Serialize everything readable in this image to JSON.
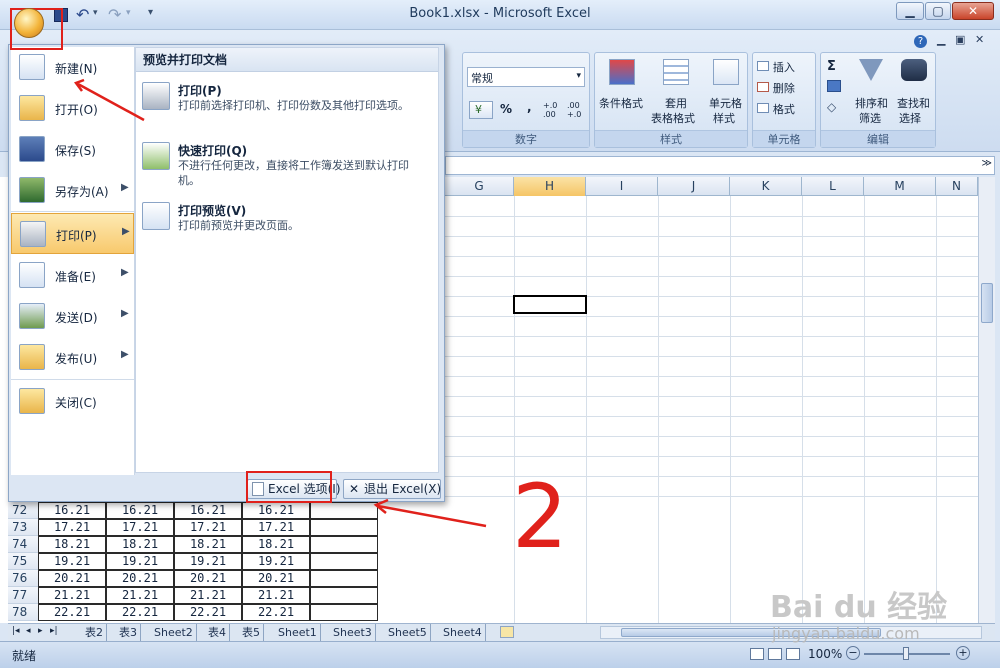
{
  "window": {
    "title": "Book1.xlsx - Microsoft Excel",
    "min_label": "▭",
    "max_label": "▢",
    "close_label": "✕"
  },
  "ribbon": {
    "number_format": "常规",
    "percent": "%",
    "comma": ",",
    "inc_decimal": "+.0 .00",
    "dec_decimal": ".00 +.0",
    "number_group": "数字",
    "styles": {
      "conditional": "条件格式",
      "table_line1": "套用",
      "table_line2": "表格格式",
      "cell_line1": "单元格",
      "cell_line2": "样式",
      "group": "样式"
    },
    "cells": {
      "insert": "插入",
      "delete": "删除",
      "format": "格式",
      "group": "单元格"
    },
    "editing": {
      "sigma": "Σ",
      "sort_line1": "排序和",
      "sort_line2": "筛选",
      "find_line1": "查找和",
      "find_line2": "选择",
      "group": "编辑"
    }
  },
  "columns": [
    "G",
    "H",
    "I",
    "J",
    "K",
    "L",
    "M",
    "N"
  ],
  "rows": [
    {
      "num": "72",
      "vals": [
        "16.21",
        "16.21",
        "16.21",
        "16.21"
      ]
    },
    {
      "num": "73",
      "vals": [
        "17.21",
        "17.21",
        "17.21",
        "17.21"
      ]
    },
    {
      "num": "74",
      "vals": [
        "18.21",
        "18.21",
        "18.21",
        "18.21"
      ]
    },
    {
      "num": "75",
      "vals": [
        "19.21",
        "19.21",
        "19.21",
        "19.21"
      ]
    },
    {
      "num": "76",
      "vals": [
        "20.21",
        "20.21",
        "20.21",
        "20.21"
      ]
    },
    {
      "num": "77",
      "vals": [
        "21.21",
        "21.21",
        "21.21",
        "21.21"
      ]
    },
    {
      "num": "78",
      "vals": [
        "22.21",
        "22.21",
        "22.21",
        "22.21"
      ]
    }
  ],
  "office_menu": {
    "items": [
      {
        "label": "新建(N)"
      },
      {
        "label": "打开(O)"
      },
      {
        "label": "保存(S)"
      },
      {
        "label": "另存为(A)"
      },
      {
        "label": "打印(P)"
      },
      {
        "label": "准备(E)"
      },
      {
        "label": "发送(D)"
      },
      {
        "label": "发布(U)"
      },
      {
        "label": "关闭(C)"
      }
    ],
    "submenu_title": "预览并打印文档",
    "sub_items": [
      {
        "title": "打印(P)",
        "desc": "打印前选择打印机、打印份数及其他打印选项。"
      },
      {
        "title": "快速打印(Q)",
        "desc": "不进行任何更改，直接将工作簿发送到默认打印机。"
      },
      {
        "title": "打印预览(V)",
        "desc": "打印前预览并更改页面。"
      }
    ],
    "excel_options": "Excel 选项(I)",
    "exit_excel": "退出 Excel(X)"
  },
  "sheet_tabs": [
    "表2",
    "表3",
    "Sheet2",
    "表4",
    "表5",
    "Sheet1",
    "Sheet3",
    "Sheet5",
    "Sheet4"
  ],
  "status": {
    "ready": "就绪",
    "zoom": "100%"
  },
  "annotation": {
    "number": "2"
  },
  "watermark": {
    "brand": "Bai du 经验",
    "url": "jingyan.baidu.com"
  }
}
